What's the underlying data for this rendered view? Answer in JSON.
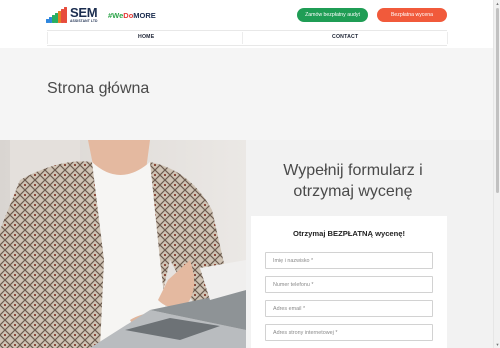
{
  "header": {
    "logo": {
      "name": "SEM",
      "subtitle": "ASSISTANT LTD",
      "bar_colors": [
        "#2e86de",
        "#2e86de",
        "#27ae60",
        "#27ae60",
        "#e67e22",
        "#e74c3c",
        "#e74c3c"
      ]
    },
    "tagline": {
      "hash": "#",
      "we": "We",
      "do": "Do",
      "more": "MORE"
    },
    "buttons": {
      "audit_label": "Zamów bezpłatny audyt",
      "quote_label": "Bezpłatna wycena"
    },
    "colors": {
      "audit_button": "#1f9d55",
      "quote_button": "#f15a3b"
    }
  },
  "nav": {
    "items": [
      {
        "label": "HOME"
      },
      {
        "label": "CONTACT"
      }
    ]
  },
  "page": {
    "title": "Strona główna"
  },
  "form": {
    "heading_line1": "Wypełnij formularz i",
    "heading_line2": "otrzymaj wycenę",
    "card_title": "Otrzymaj BEZPŁATNĄ wycenę!",
    "fields": [
      {
        "placeholder": "Imię i nazwisko *"
      },
      {
        "placeholder": "Numer telefonu *"
      },
      {
        "placeholder": "Adres email *"
      },
      {
        "placeholder": "Adres strony internetowej *"
      }
    ]
  }
}
